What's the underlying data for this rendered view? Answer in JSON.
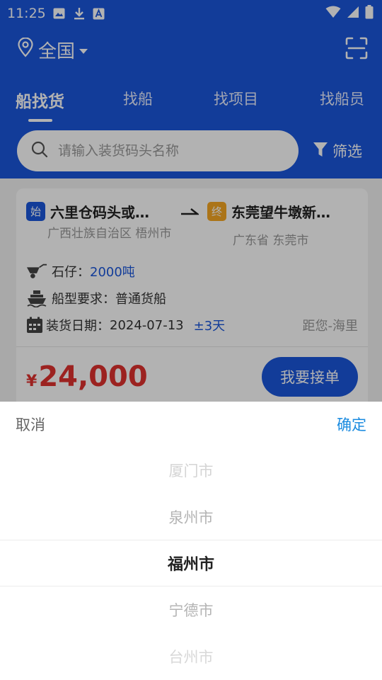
{
  "status_bar": {
    "time": "11:25"
  },
  "location": {
    "label": "全国"
  },
  "tabs": [
    {
      "label": "船找货",
      "active": true
    },
    {
      "label": "找船",
      "active": false
    },
    {
      "label": "找项目",
      "active": false
    },
    {
      "label": "找船员",
      "active": false
    }
  ],
  "search": {
    "placeholder": "请输入装货码头名称"
  },
  "filter": {
    "label": "筛选"
  },
  "card": {
    "start": {
      "badge": "始",
      "name": "六里仓码头或…",
      "region": "广西壮族自治区 梧州市"
    },
    "end": {
      "badge": "终",
      "name": "东莞望牛墩新…",
      "region": "广东省 东莞市"
    },
    "cargo_label": "石仔：",
    "cargo_value": "2000吨",
    "ship_type_label": "船型要求：",
    "ship_type_value": "普通货船",
    "date_label": "装货日期：",
    "date_value": "2024-07-13",
    "date_range": "±3天",
    "distance": "距您-海里",
    "price_symbol": "¥",
    "price": "24,000",
    "action": "我要接单"
  },
  "picker": {
    "cancel": "取消",
    "confirm": "确定",
    "items": [
      "厦门市",
      "泉州市",
      "福州市",
      "宁德市",
      "台州市"
    ],
    "selected_index": 2
  },
  "colors": {
    "brand": "#1a56db",
    "price": "#e0312f",
    "confirm": "#1a8be0",
    "end_badge": "#f5a623"
  }
}
